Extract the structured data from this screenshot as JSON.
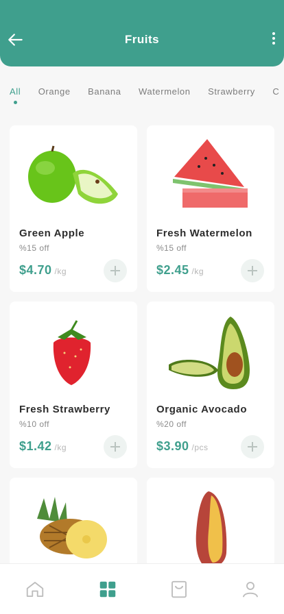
{
  "header": {
    "title": "Fruits"
  },
  "categories": [
    {
      "label": "All",
      "active": true
    },
    {
      "label": "Orange"
    },
    {
      "label": "Banana"
    },
    {
      "label": "Watermelon"
    },
    {
      "label": "Strawberry"
    },
    {
      "label": "C"
    }
  ],
  "products": [
    {
      "name": "Green Apple",
      "discount": "%15 off",
      "price": "$4.70",
      "unit": "/kg",
      "icon": "green-apple-image"
    },
    {
      "name": "Fresh Watermelon",
      "discount": "%15 off",
      "price": "$2.45",
      "unit": "/kg",
      "icon": "watermelon-image"
    },
    {
      "name": "Fresh Strawberry",
      "discount": "%10 off",
      "price": "$1.42",
      "unit": "/kg",
      "icon": "strawberry-image"
    },
    {
      "name": "Organic Avocado",
      "discount": "%20 off",
      "price": "$3.90",
      "unit": "/pcs",
      "icon": "avocado-image"
    }
  ],
  "bottom_nav": [
    {
      "name": "home-icon",
      "active": false
    },
    {
      "name": "grid-icon",
      "active": true
    },
    {
      "name": "bag-icon",
      "active": false
    },
    {
      "name": "profile-icon",
      "active": false
    }
  ],
  "colors": {
    "accent": "#3f9f8d",
    "bg": "#f7f7f7",
    "muted": "#7c7c7c"
  }
}
